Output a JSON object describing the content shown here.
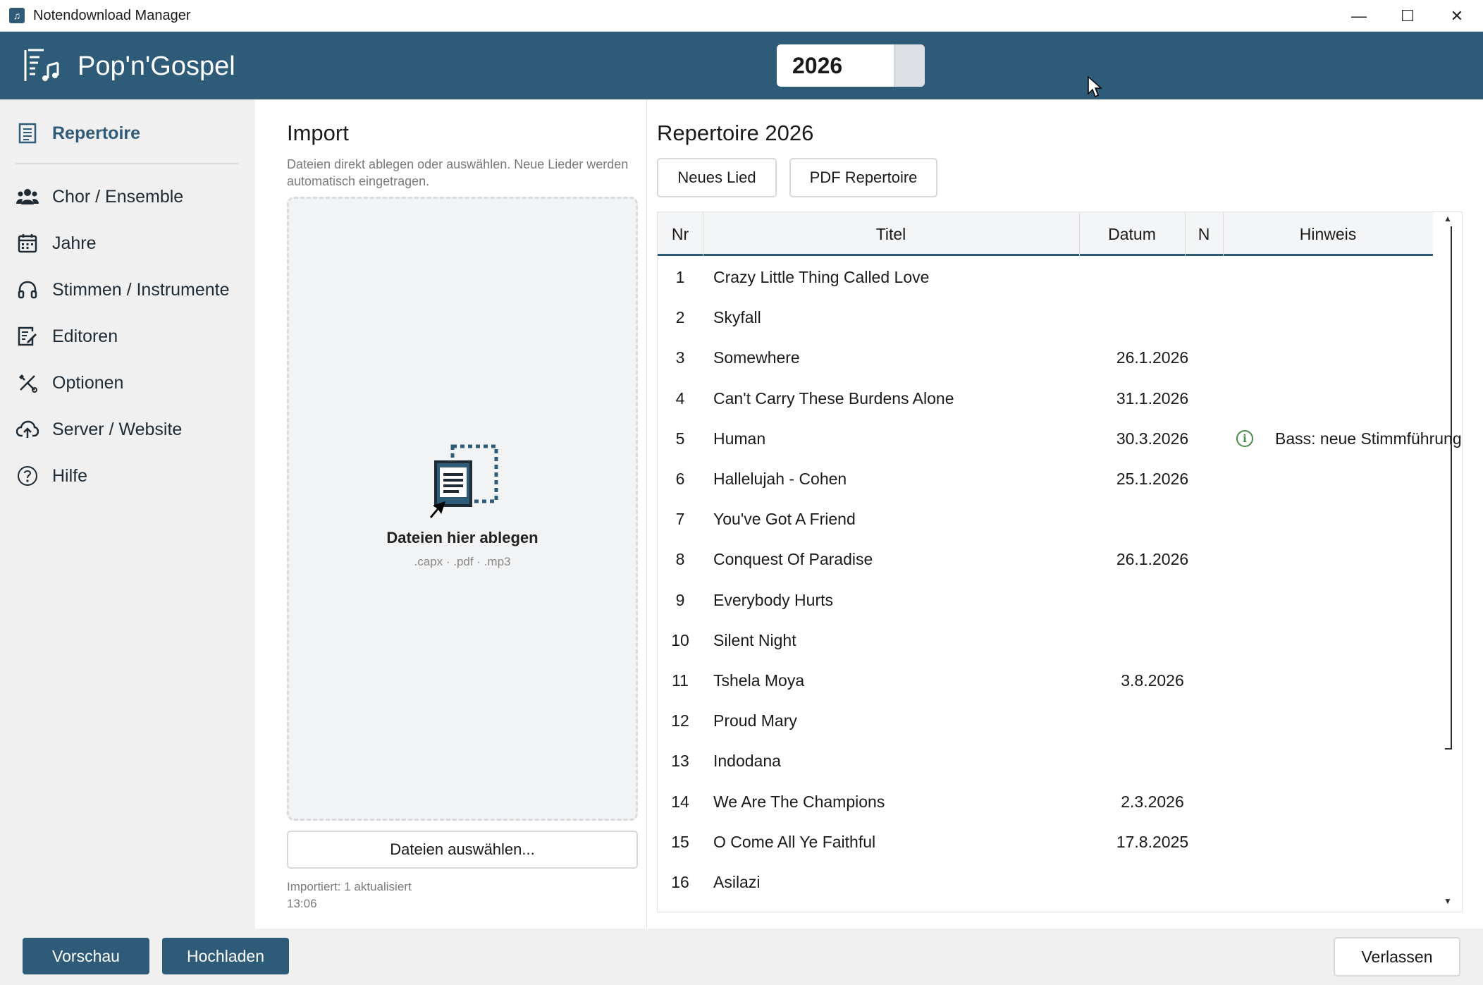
{
  "window": {
    "title": "Notendownload Manager",
    "minimize": "—",
    "maximize": "☐",
    "close": "✕"
  },
  "header": {
    "brand": "Pop'n'Gospel",
    "year": "2026"
  },
  "sidebar": {
    "items": [
      {
        "label": "Repertoire",
        "icon": "repertoire-icon",
        "active": true
      },
      {
        "label": "Chor / Ensemble",
        "icon": "people-icon"
      },
      {
        "label": "Jahre",
        "icon": "calendar-icon"
      },
      {
        "label": "Stimmen / Instrumente",
        "icon": "headphones-icon"
      },
      {
        "label": "Editoren",
        "icon": "edit-icon"
      },
      {
        "label": "Optionen",
        "icon": "tools-icon"
      },
      {
        "label": "Server / Website",
        "icon": "cloud-upload-icon"
      },
      {
        "label": "Hilfe",
        "icon": "help-icon"
      }
    ]
  },
  "import": {
    "title": "Import",
    "description": "Dateien direkt ablegen oder auswählen. Neue Lieder werden automatisch eingetragen.",
    "drop_label": "Dateien hier ablegen",
    "drop_types": ".capx · .pdf · .mp3",
    "select_button": "Dateien auswählen...",
    "status_line1": "Importiert: 1 aktualisiert",
    "status_line2": "13:06"
  },
  "repertoire": {
    "title": "Repertoire 2026",
    "new_song_button": "Neues Lied",
    "pdf_button": "PDF Repertoire",
    "columns": [
      "Nr",
      "Titel",
      "Datum",
      "N",
      "Hinweis"
    ],
    "rows": [
      {
        "nr": "1",
        "title": "Crazy Little Thing Called Love",
        "date": "",
        "n": "",
        "hint": ""
      },
      {
        "nr": "2",
        "title": "Skyfall",
        "date": "",
        "n": "",
        "hint": ""
      },
      {
        "nr": "3",
        "title": "Somewhere",
        "date": "26.1.2026",
        "n": "",
        "hint": ""
      },
      {
        "nr": "4",
        "title": "Can't Carry These Burdens Alone",
        "date": "31.1.2026",
        "n": "",
        "hint": ""
      },
      {
        "nr": "5",
        "title": "Human",
        "date": "30.3.2026",
        "n": "i",
        "hint": "Bass: neue Stimmführung"
      },
      {
        "nr": "6",
        "title": "Hallelujah - Cohen",
        "date": "25.1.2026",
        "n": "",
        "hint": ""
      },
      {
        "nr": "7",
        "title": "You've Got A Friend",
        "date": "",
        "n": "",
        "hint": ""
      },
      {
        "nr": "8",
        "title": "Conquest Of Paradise",
        "date": "26.1.2026",
        "n": "",
        "hint": ""
      },
      {
        "nr": "9",
        "title": "Everybody Hurts",
        "date": "",
        "n": "",
        "hint": ""
      },
      {
        "nr": "10",
        "title": "Silent Night",
        "date": "",
        "n": "",
        "hint": ""
      },
      {
        "nr": "11",
        "title": "Tshela Moya",
        "date": "3.8.2026",
        "n": "",
        "hint": ""
      },
      {
        "nr": "12",
        "title": "Proud Mary",
        "date": "",
        "n": "",
        "hint": ""
      },
      {
        "nr": "13",
        "title": "Indodana",
        "date": "",
        "n": "",
        "hint": ""
      },
      {
        "nr": "14",
        "title": "We Are The Champions",
        "date": "2.3.2026",
        "n": "",
        "hint": ""
      },
      {
        "nr": "15",
        "title": "O Come All Ye Faithful",
        "date": "17.8.2025",
        "n": "",
        "hint": ""
      },
      {
        "nr": "16",
        "title": "Asilazi",
        "date": "",
        "n": "",
        "hint": ""
      }
    ]
  },
  "footer": {
    "preview_button": "Vorschau",
    "upload_button": "Hochladen",
    "exit_button": "Verlassen"
  },
  "colors": {
    "primary": "#2d5b78",
    "info": "#4a8a4a"
  }
}
